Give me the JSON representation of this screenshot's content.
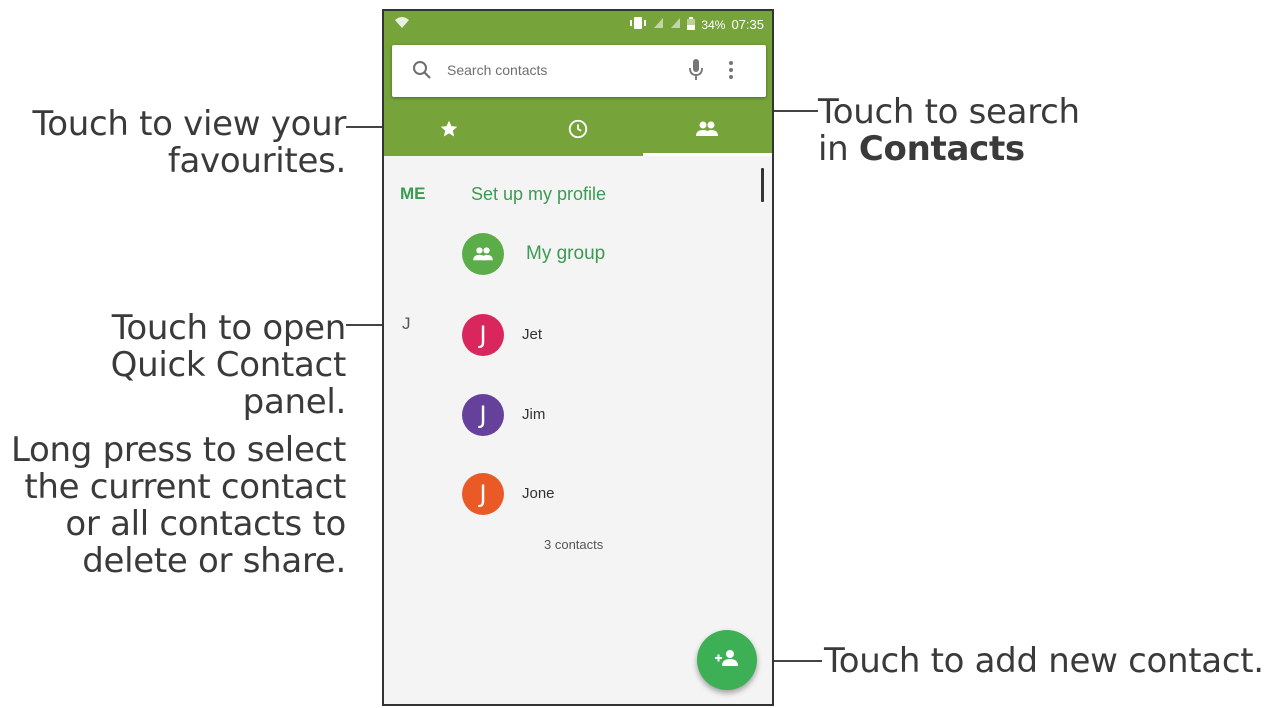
{
  "callouts": {
    "favourites": {
      "line1": "Touch to view your",
      "line2": "favourites."
    },
    "search": {
      "line1": "Touch to search",
      "line2_prefix": "in ",
      "line2_bold": "Contacts"
    },
    "quick_contact": {
      "line1": "Touch to open",
      "line2": "Quick Contact",
      "line3": "panel."
    },
    "long_press": {
      "line1": "Long press to select",
      "line2": "the current contact",
      "line3": "or all contacts to",
      "line4": "delete or share."
    },
    "add_contact": {
      "line1": "Touch to add new contact."
    }
  },
  "status_bar": {
    "battery": "34%",
    "time": "07:35"
  },
  "search": {
    "placeholder": "Search contacts"
  },
  "tabs": [
    {
      "icon": "star-icon",
      "active": false
    },
    {
      "icon": "clock-icon",
      "active": false
    },
    {
      "icon": "people-icon",
      "active": true
    }
  ],
  "profile": {
    "tag": "ME",
    "action": "Set up my profile"
  },
  "group": {
    "name": "My group",
    "color": "#5aad48"
  },
  "section_letter": "J",
  "contacts": [
    {
      "initial": "J",
      "name": "Jet",
      "color": "#d9265d"
    },
    {
      "initial": "J",
      "name": "Jim",
      "color": "#65419c"
    },
    {
      "initial": "J",
      "name": "Jone",
      "color": "#ea5a27"
    }
  ],
  "contact_count": "3 contacts",
  "colors": {
    "app_bar": "#76a33a",
    "accent_text": "#3d9a52",
    "fab": "#3db055"
  }
}
